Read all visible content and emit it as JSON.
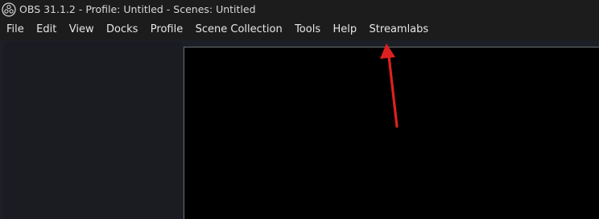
{
  "window": {
    "title": "OBS 31.1.2 - Profile: Untitled - Scenes: Untitled",
    "icon": "obs-logo-icon"
  },
  "menubar": {
    "items": [
      {
        "label": "File"
      },
      {
        "label": "Edit"
      },
      {
        "label": "View"
      },
      {
        "label": "Docks"
      },
      {
        "label": "Profile"
      },
      {
        "label": "Scene Collection"
      },
      {
        "label": "Tools"
      },
      {
        "label": "Help"
      },
      {
        "label": "Streamlabs"
      }
    ]
  },
  "annotation": {
    "type": "arrow",
    "color": "#e02020",
    "target": "Streamlabs"
  },
  "colors": {
    "titlebar_bg": "#1c1c1c",
    "menubar_bg": "#1c1c1c",
    "workspace_bg": "#1d1f26",
    "preview_bg": "#000000",
    "text": "#e6e6e6"
  }
}
